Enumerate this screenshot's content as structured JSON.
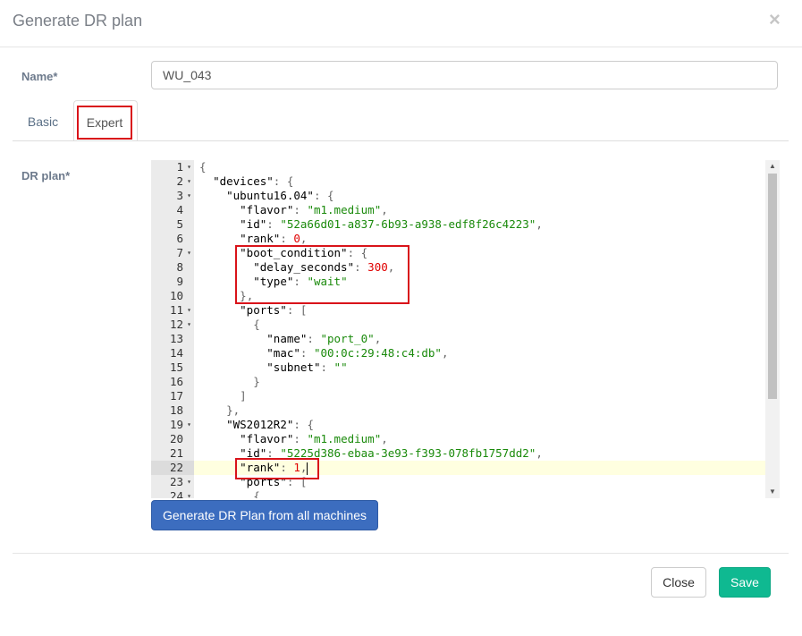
{
  "modal": {
    "title": "Generate DR plan",
    "close_icon": "×"
  },
  "form": {
    "name_label": "Name*",
    "name_value": "WU_043",
    "dr_plan_label": "DR plan*"
  },
  "tabs": [
    {
      "label": "Basic",
      "active": false
    },
    {
      "label": "Expert",
      "active": true
    }
  ],
  "editor": {
    "active_line": 22,
    "lines": [
      {
        "n": "1",
        "fold": true,
        "code": "{"
      },
      {
        "n": "2",
        "fold": true,
        "code": "  \"devices\": {"
      },
      {
        "n": "3",
        "fold": true,
        "code": "    \"ubuntu16.04\": {"
      },
      {
        "n": "4",
        "fold": false,
        "code": "      \"flavor\": \"m1.medium\","
      },
      {
        "n": "5",
        "fold": false,
        "code": "      \"id\": \"52a66d01-a837-6b93-a938-edf8f26c4223\","
      },
      {
        "n": "6",
        "fold": false,
        "code": "      \"rank\": 0,"
      },
      {
        "n": "7",
        "fold": true,
        "code": "      \"boot_condition\": {"
      },
      {
        "n": "8",
        "fold": false,
        "code": "        \"delay_seconds\": 300,"
      },
      {
        "n": "9",
        "fold": false,
        "code": "        \"type\": \"wait\""
      },
      {
        "n": "10",
        "fold": false,
        "code": "      },"
      },
      {
        "n": "11",
        "fold": true,
        "code": "      \"ports\": ["
      },
      {
        "n": "12",
        "fold": true,
        "code": "        {"
      },
      {
        "n": "13",
        "fold": false,
        "code": "          \"name\": \"port_0\","
      },
      {
        "n": "14",
        "fold": false,
        "code": "          \"mac\": \"00:0c:29:48:c4:db\","
      },
      {
        "n": "15",
        "fold": false,
        "code": "          \"subnet\": \"\""
      },
      {
        "n": "16",
        "fold": false,
        "code": "        }"
      },
      {
        "n": "17",
        "fold": false,
        "code": "      ]"
      },
      {
        "n": "18",
        "fold": false,
        "code": "    },"
      },
      {
        "n": "19",
        "fold": true,
        "code": "    \"WS2012R2\": {"
      },
      {
        "n": "20",
        "fold": false,
        "code": "      \"flavor\": \"m1.medium\","
      },
      {
        "n": "21",
        "fold": false,
        "code": "      \"id\": \"5225d386-ebaa-3e93-f393-078fb1757dd2\","
      },
      {
        "n": "22",
        "fold": false,
        "code": "      \"rank\": 1,"
      },
      {
        "n": "23",
        "fold": true,
        "code": "      \"ports\": ["
      },
      {
        "n": "24",
        "fold": true,
        "code": "        {"
      }
    ]
  },
  "buttons": {
    "generate": "Generate DR Plan from all machines",
    "close": "Close",
    "save": "Save"
  },
  "colors": {
    "primary": "#3c6dbf",
    "success": "#0fb991",
    "highlight": "#d9131a"
  }
}
